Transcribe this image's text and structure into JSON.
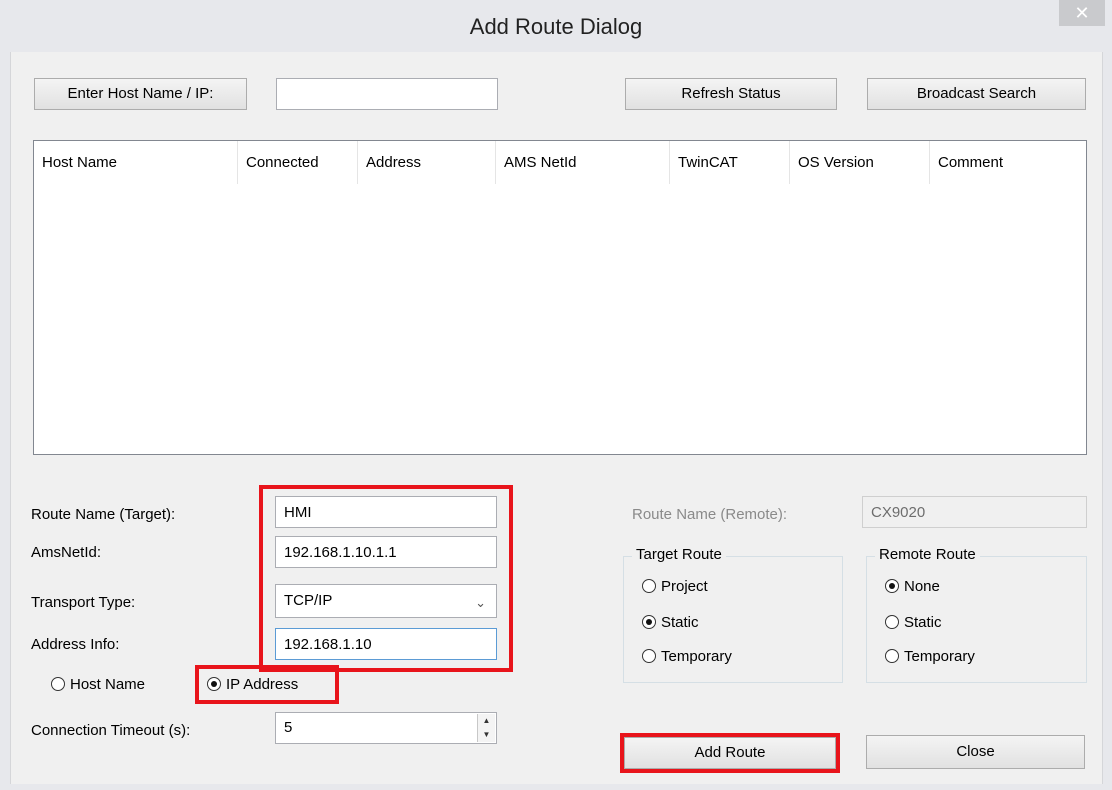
{
  "window": {
    "title": "Add Route Dialog",
    "close_glyph": "✕"
  },
  "toolbar": {
    "enter_host_label": "Enter Host Name / IP:",
    "host_input_value": "",
    "refresh_label": "Refresh Status",
    "broadcast_label": "Broadcast Search"
  },
  "table": {
    "columns": [
      "Host Name",
      "Connected",
      "Address",
      "AMS NetId",
      "TwinCAT",
      "OS Version",
      "Comment"
    ],
    "rows": []
  },
  "form": {
    "route_name_label": "Route Name (Target):",
    "route_name_value": "HMI",
    "amsnetid_label": "AmsNetId:",
    "amsnetid_value": "192.168.1.10.1.1",
    "transport_label": "Transport Type:",
    "transport_value": "TCP/IP",
    "address_label": "Address Info:",
    "address_value": "192.168.1.10",
    "hostname_radio": "Host Name",
    "ipaddress_radio": "IP Address",
    "timeout_label": "Connection Timeout (s):",
    "timeout_value": "5"
  },
  "remote": {
    "route_name_label": "Route Name (Remote):",
    "route_name_value": "CX9020"
  },
  "target_route": {
    "title": "Target Route",
    "options": [
      "Project",
      "Static",
      "Temporary"
    ],
    "selected": "Static"
  },
  "remote_route": {
    "title": "Remote Route",
    "options": [
      "None",
      "Static",
      "Temporary"
    ],
    "selected": "None"
  },
  "buttons": {
    "add_route": "Add Route",
    "close": "Close"
  },
  "colors": {
    "highlight": "#e8141b",
    "background": "#f0f0f0"
  },
  "icons": {
    "dropdown": "chevron-down-icon",
    "spinner_up": "arrow-up-icon",
    "spinner_down": "arrow-down-icon",
    "close": "close-icon"
  }
}
